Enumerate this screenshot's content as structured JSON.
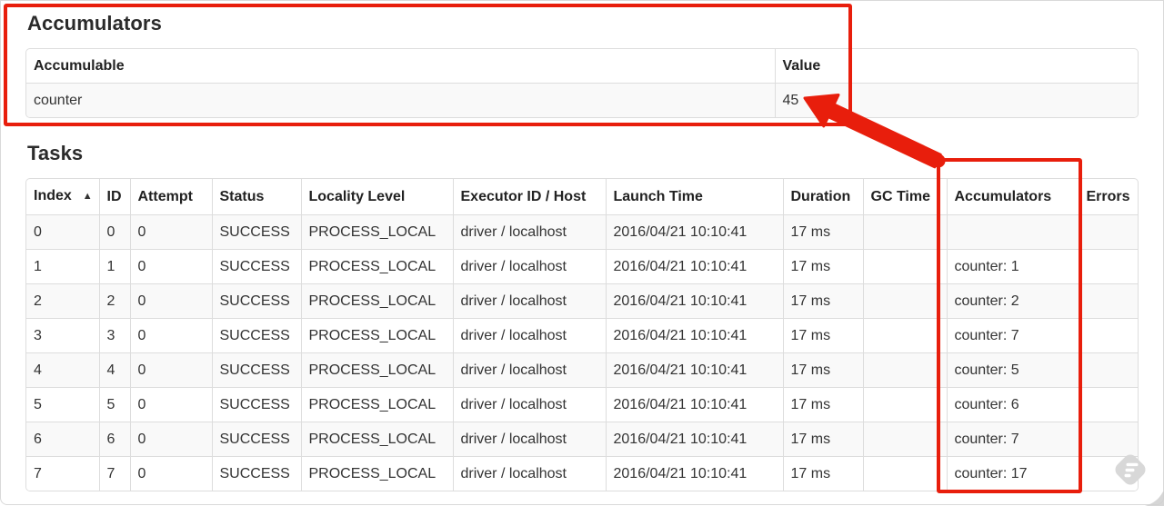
{
  "annotation_color": "#e81e0c",
  "accumulators_section": {
    "title": "Accumulators",
    "table": {
      "headers": [
        "Accumulable",
        "Value"
      ],
      "rows": [
        {
          "accumulable": "counter",
          "value": "45"
        }
      ]
    }
  },
  "tasks_section": {
    "title": "Tasks",
    "table": {
      "headers": [
        "Index",
        "ID",
        "Attempt",
        "Status",
        "Locality Level",
        "Executor ID / Host",
        "Launch Time",
        "Duration",
        "GC Time",
        "Accumulators",
        "Errors"
      ],
      "sort_column": "Index",
      "sort_icon": "▲",
      "rows": [
        {
          "index": "0",
          "id": "0",
          "attempt": "0",
          "status": "SUCCESS",
          "locality": "PROCESS_LOCAL",
          "executor": "driver / localhost",
          "launch": "2016/04/21 10:10:41",
          "duration": "17 ms",
          "gc": "",
          "accumulators": "",
          "errors": ""
        },
        {
          "index": "1",
          "id": "1",
          "attempt": "0",
          "status": "SUCCESS",
          "locality": "PROCESS_LOCAL",
          "executor": "driver / localhost",
          "launch": "2016/04/21 10:10:41",
          "duration": "17 ms",
          "gc": "",
          "accumulators": "counter: 1",
          "errors": ""
        },
        {
          "index": "2",
          "id": "2",
          "attempt": "0",
          "status": "SUCCESS",
          "locality": "PROCESS_LOCAL",
          "executor": "driver / localhost",
          "launch": "2016/04/21 10:10:41",
          "duration": "17 ms",
          "gc": "",
          "accumulators": "counter: 2",
          "errors": ""
        },
        {
          "index": "3",
          "id": "3",
          "attempt": "0",
          "status": "SUCCESS",
          "locality": "PROCESS_LOCAL",
          "executor": "driver / localhost",
          "launch": "2016/04/21 10:10:41",
          "duration": "17 ms",
          "gc": "",
          "accumulators": "counter: 7",
          "errors": ""
        },
        {
          "index": "4",
          "id": "4",
          "attempt": "0",
          "status": "SUCCESS",
          "locality": "PROCESS_LOCAL",
          "executor": "driver / localhost",
          "launch": "2016/04/21 10:10:41",
          "duration": "17 ms",
          "gc": "",
          "accumulators": "counter: 5",
          "errors": ""
        },
        {
          "index": "5",
          "id": "5",
          "attempt": "0",
          "status": "SUCCESS",
          "locality": "PROCESS_LOCAL",
          "executor": "driver / localhost",
          "launch": "2016/04/21 10:10:41",
          "duration": "17 ms",
          "gc": "",
          "accumulators": "counter: 6",
          "errors": ""
        },
        {
          "index": "6",
          "id": "6",
          "attempt": "0",
          "status": "SUCCESS",
          "locality": "PROCESS_LOCAL",
          "executor": "driver / localhost",
          "launch": "2016/04/21 10:10:41",
          "duration": "17 ms",
          "gc": "",
          "accumulators": "counter: 7",
          "errors": ""
        },
        {
          "index": "7",
          "id": "7",
          "attempt": "0",
          "status": "SUCCESS",
          "locality": "PROCESS_LOCAL",
          "executor": "driver / localhost",
          "launch": "2016/04/21 10:10:41",
          "duration": "17 ms",
          "gc": "",
          "accumulators": "counter: 17",
          "errors": ""
        }
      ]
    }
  }
}
